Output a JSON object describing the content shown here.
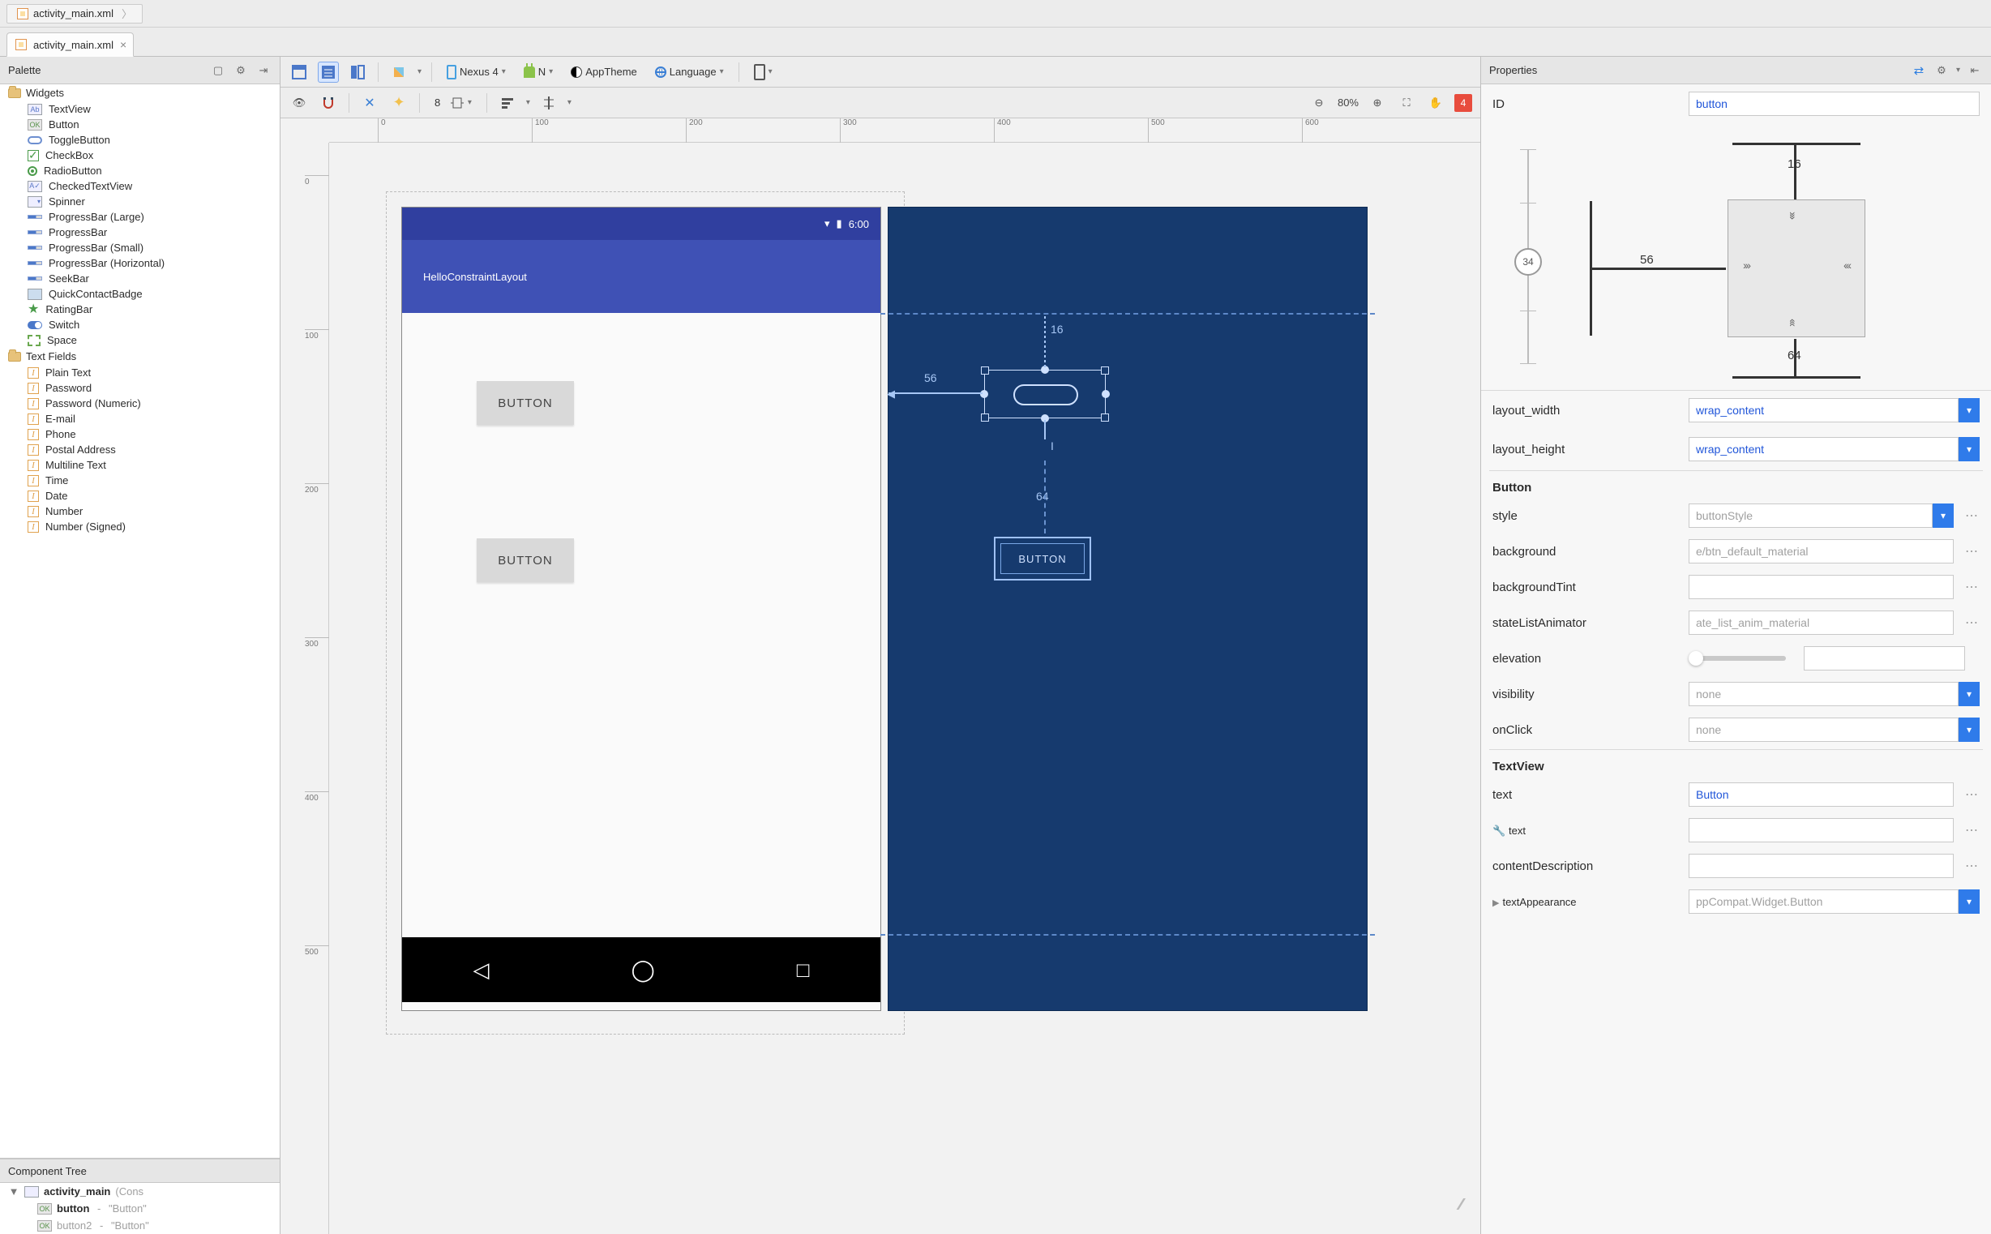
{
  "breadcrumb": {
    "file": "activity_main.xml"
  },
  "tab": {
    "file": "activity_main.xml"
  },
  "palette": {
    "title": "Palette",
    "groups": [
      {
        "name": "Widgets",
        "items": [
          "TextView",
          "Button",
          "ToggleButton",
          "CheckBox",
          "RadioButton",
          "CheckedTextView",
          "Spinner",
          "ProgressBar (Large)",
          "ProgressBar",
          "ProgressBar (Small)",
          "ProgressBar (Horizontal)",
          "SeekBar",
          "QuickContactBadge",
          "RatingBar",
          "Switch",
          "Space"
        ]
      },
      {
        "name": "Text Fields",
        "items": [
          "Plain Text",
          "Password",
          "Password (Numeric)",
          "E-mail",
          "Phone",
          "Postal Address",
          "Multiline Text",
          "Time",
          "Date",
          "Number",
          "Number (Signed)"
        ]
      }
    ]
  },
  "componentTree": {
    "title": "Component Tree",
    "root": {
      "name": "activity_main",
      "type": "(ConstraintLayout)"
    },
    "children": [
      {
        "id": "button",
        "text": "\"Button\"",
        "selected": true
      },
      {
        "id": "button2",
        "text": "\"Button\"",
        "selected": false
      }
    ]
  },
  "editorToolbar": {
    "device": "Nexus 4",
    "api": "N",
    "theme": "AppTheme",
    "locale": "Language",
    "zoom": "80%",
    "warnCount": "4",
    "autoconnectNum": "8"
  },
  "designSurface": {
    "statusTime": "6:00",
    "appTitle": "HelloConstraintLayout",
    "btn1": "BUTTON",
    "btn2": "BUTTON",
    "rulerH": [
      "0",
      "100",
      "200",
      "300",
      "400",
      "500",
      "600"
    ],
    "rulerV": [
      "0",
      "100",
      "200",
      "300",
      "400",
      "500"
    ]
  },
  "blueprint": {
    "marginTop": "16",
    "marginLeft": "56",
    "marginBottomGap": "64",
    "btn2": "BUTTON"
  },
  "properties": {
    "title": "Properties",
    "id_label": "ID",
    "id_value": "button",
    "constraints": {
      "top": "16",
      "left": "56",
      "bottom": "64",
      "sliderValue": "34"
    },
    "layout_width_label": "layout_width",
    "layout_width_value": "wrap_content",
    "layout_height_label": "layout_height",
    "layout_height_value": "wrap_content",
    "section_button": "Button",
    "style_label": "style",
    "style_value": "buttonStyle",
    "background_label": "background",
    "background_value": "e/btn_default_material",
    "backgroundTint_label": "backgroundTint",
    "backgroundTint_value": "",
    "stateListAnimator_label": "stateListAnimator",
    "stateListAnimator_value": "ate_list_anim_material",
    "elevation_label": "elevation",
    "elevation_value": "",
    "visibility_label": "visibility",
    "visibility_value": "none",
    "onClick_label": "onClick",
    "onClick_value": "none",
    "section_textview": "TextView",
    "text_label": "text",
    "text_value": "Button",
    "text2_label": "text",
    "text2_value": "",
    "contentDescription_label": "contentDescription",
    "contentDescription_value": "",
    "textAppearance_label": "textAppearance",
    "textAppearance_value": "ppCompat.Widget.Button"
  }
}
